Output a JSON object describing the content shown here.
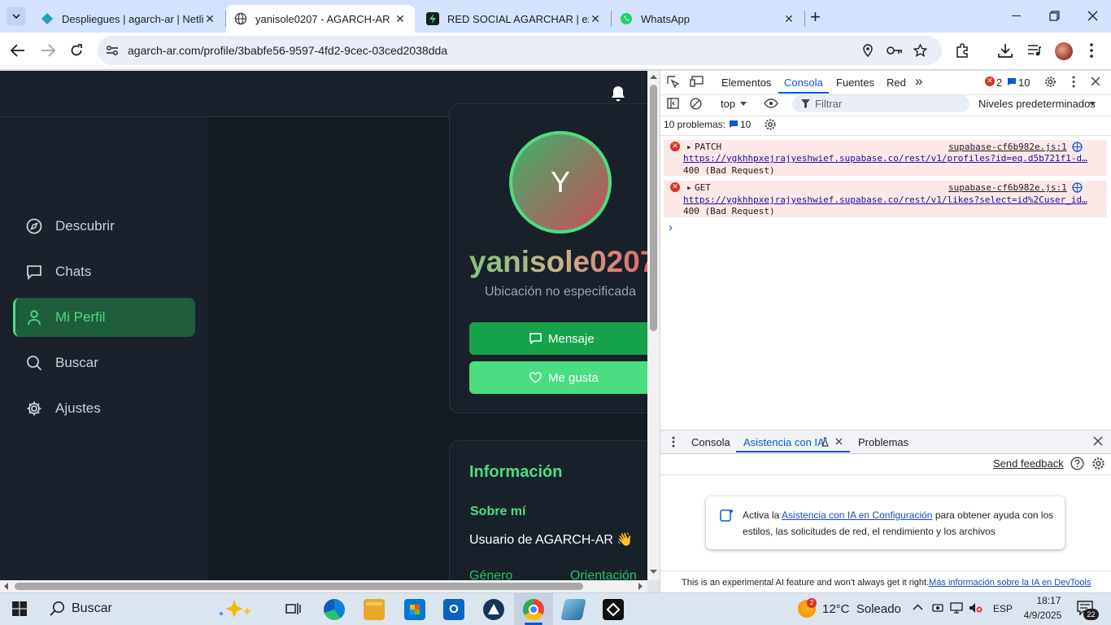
{
  "browser": {
    "tabs": [
      {
        "title": "Despliegues | agarch-ar | Netlify",
        "favicon": "netlify-icon",
        "close": "✕"
      },
      {
        "title": "yanisole0207 - AGARCH-AR",
        "favicon": "globe-icon",
        "close": "✕"
      },
      {
        "title": "RED SOCIAL AGARCHAR | ezequiel",
        "favicon": "supabase-icon",
        "close": "✕"
      },
      {
        "title": "WhatsApp",
        "favicon": "whatsapp-icon",
        "close": "✕"
      }
    ],
    "new_tab": "+",
    "url": "agarch-ar.com/profile/3babfe56-9597-4fd2-9cec-03ced2038dda"
  },
  "app": {
    "nav": [
      {
        "label": "Descubrir",
        "icon": "compass-icon",
        "active": false
      },
      {
        "label": "Chats",
        "icon": "chat-icon",
        "active": false
      },
      {
        "label": "Mi Perfil",
        "icon": "user-icon",
        "active": true
      },
      {
        "label": "Buscar",
        "icon": "search-icon",
        "active": false
      },
      {
        "label": "Ajustes",
        "icon": "gear-icon",
        "active": false
      }
    ],
    "profile": {
      "avatar_letter": "Y",
      "username": "yanisole0207",
      "location": "Ubicación no especificada",
      "message_button": "Mensaje",
      "like_button": "Me gusta"
    },
    "info": {
      "heading": "Información",
      "about_heading": "Sobre mí",
      "about_text": "Usuario de AGARCH-AR 👋",
      "gender_label": "Género",
      "orientation_label": "Orientación"
    },
    "colors": {
      "accent": "#4ade80",
      "dark_accent": "#16a34a",
      "background": "#131a22"
    }
  },
  "devtools": {
    "tabs": [
      "Elementos",
      "Consola",
      "Fuentes",
      "Red"
    ],
    "active_tab": "Consola",
    "more_tabs": "»",
    "error_count": "2",
    "message_count": "10",
    "context": "top",
    "filter_placeholder": "Filtrar",
    "levels": "Niveles predeterminados",
    "problems_label": "10 problemas:",
    "problems_count": "10",
    "console_errors": [
      {
        "method": "PATCH",
        "source": "supabase-cf6b982e.js:1",
        "url": "https://ygkhhpxejrajyeshwief.supabase.co/rest/v1/profiles?id=eq.d5b721f1-d…",
        "status": "400 (Bad Request)"
      },
      {
        "method": "GET",
        "source": "supabase-cf6b982e.js:1",
        "url": "https://ygkhhpxejrajyeshwief.supabase.co/rest/v1/likes?select=id%2Cuser_id…",
        "status": "400 (Bad Request)"
      }
    ],
    "prompt": "›",
    "drawer_tabs": [
      "Consola",
      "Asistencia con IA",
      "Problemas"
    ],
    "drawer_active": "Asistencia con IA",
    "send_feedback": "Send feedback",
    "ai_text_before": "Activa la ",
    "ai_link": "Asistencia con IA en Configuración",
    "ai_text_after": " para obtener ayuda con los estilos, las solicitudes de red, el rendimiento y los archivos",
    "footer_text": "This is an experimental AI feature and won't always get it right.",
    "footer_link": "Más información sobre la IA en DevTools"
  },
  "taskbar": {
    "search_placeholder": "Buscar",
    "weather": "12°C  Soleado",
    "weather_badge": "2",
    "language": "ESP",
    "time": "18:17",
    "date": "4/9/2025",
    "notifications": "22"
  }
}
